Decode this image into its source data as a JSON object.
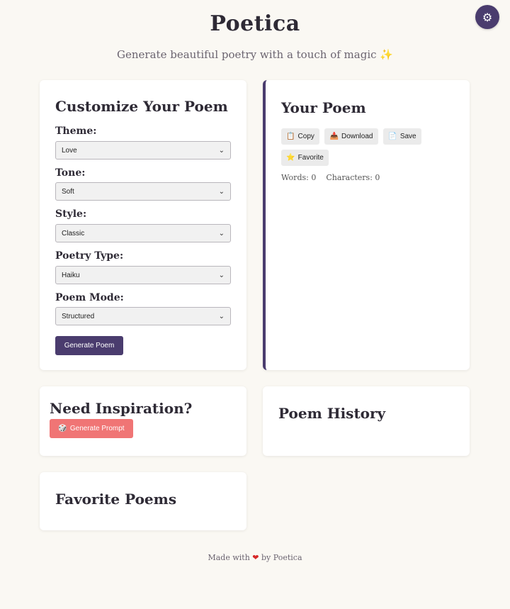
{
  "header": {
    "title": "Poetica",
    "subtitle": "Generate beautiful poetry with a touch of magic ✨",
    "settings_icon": "⚙"
  },
  "customize": {
    "heading": "Customize Your Poem",
    "fields": [
      {
        "label": "Theme:",
        "value": "Love"
      },
      {
        "label": "Tone:",
        "value": "Soft"
      },
      {
        "label": "Style:",
        "value": "Classic"
      },
      {
        "label": "Poetry Type:",
        "value": "Haiku"
      },
      {
        "label": "Poem Mode:",
        "value": "Structured"
      }
    ],
    "generate_label": "Generate Poem"
  },
  "poem": {
    "heading": "Your Poem",
    "copy": {
      "icon": "📋",
      "label": "Copy"
    },
    "download": {
      "icon": "📥",
      "label": "Download"
    },
    "save": {
      "icon": "📄",
      "label": "Save"
    },
    "favorite": {
      "icon": "⭐",
      "label": "Favorite"
    },
    "words_label": "Words: 0",
    "chars_label": "Characters: 0"
  },
  "inspiration": {
    "heading": "Need Inspiration?",
    "button_icon": "🎲",
    "button_label": "Generate Prompt"
  },
  "history": {
    "heading": "Poem History"
  },
  "favorites": {
    "heading": "Favorite Poems"
  },
  "footer": {
    "prefix": "Made with",
    "heart": "❤",
    "suffix": "by Poetica"
  },
  "colors": {
    "accent": "#4a3c6e",
    "prompt_button": "#f07575",
    "background": "#faf8f3"
  }
}
